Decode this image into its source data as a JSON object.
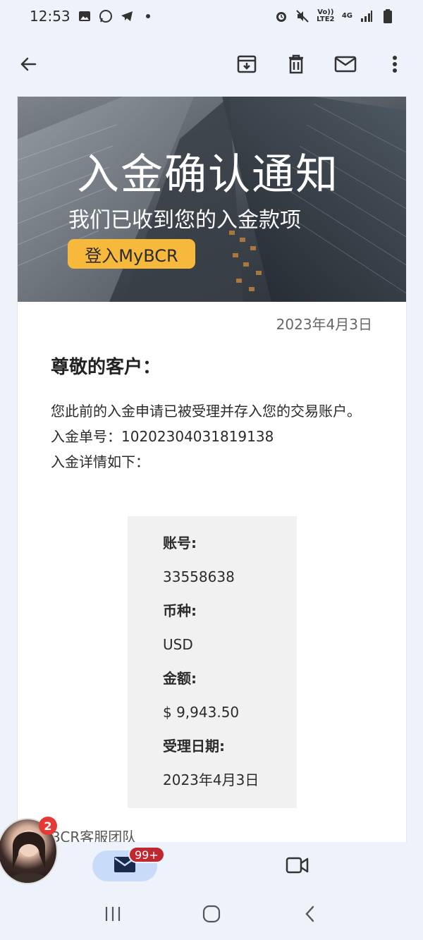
{
  "status_bar": {
    "time": "12:53",
    "left_icons": [
      "gallery-icon",
      "whatsapp-icon",
      "telegram-icon",
      "dot-icon"
    ],
    "right_icons": [
      "alarm-icon",
      "mute-icon",
      "volte-icon",
      "4g-icon",
      "signal-icon",
      "battery-icon"
    ],
    "volte_label": "Vo)) LTE2",
    "net_label": "4G"
  },
  "app_bar": {
    "back_icon": "arrow-back-icon",
    "actions": [
      "archive-icon",
      "delete-icon",
      "mark-unread-icon",
      "more-vert-icon"
    ]
  },
  "email": {
    "banner": {
      "title": "入金确认通知",
      "subtitle": "我们已收到您的入金款项",
      "button_label": "登入MyBCR"
    },
    "date": "2023年4月3日",
    "greeting": "尊敬的客户：",
    "body_lines": [
      "您此前的入金申请已被受理并存入您的交易账户。",
      "入金单号：10202304031819138",
      "入金详情如下："
    ],
    "details": [
      {
        "label": "账号:",
        "value": "33558638"
      },
      {
        "label": "币种:",
        "value": "USD"
      },
      {
        "label": "金额:",
        "value": "$ 9,943.50"
      },
      {
        "label": "受理日期:",
        "value": "2023年4月3日"
      }
    ],
    "signoff": "BCR客服团队"
  },
  "bottom_nav": {
    "mail_badge": "99+",
    "mail_icon": "mail-icon",
    "video_icon": "video-icon"
  },
  "chat_head": {
    "badge": "2"
  },
  "system_nav": [
    "recents-icon",
    "home-icon",
    "back-icon"
  ],
  "colors": {
    "accent_button": "#f6b93b",
    "mail_pill": "#c8dcfa",
    "badge_red": "#c0282f",
    "background": "#eef2fb"
  }
}
